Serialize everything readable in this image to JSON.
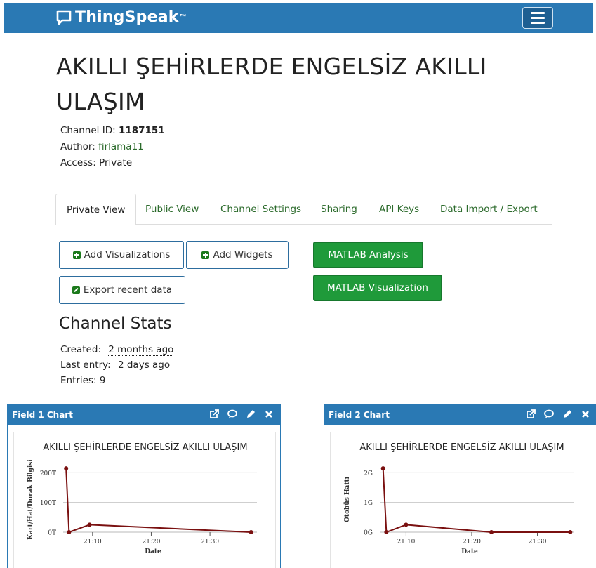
{
  "navbar": {
    "brand": "ThingSpeak",
    "brand_tm": "™",
    "brand_color": "#2a79b4"
  },
  "channel": {
    "title_line1": "AKILLI ŞEHİRLERDE ENGELSİZ AKILLI",
    "title_line2": "ULAŞIM",
    "id_label": "Channel ID:",
    "id_value": "1187151",
    "author_label": "Author:",
    "author_value": "firlama11",
    "access_label": "Access:",
    "access_value": "Private"
  },
  "tabs": [
    {
      "label": "Private View",
      "active": true
    },
    {
      "label": "Public View"
    },
    {
      "label": "Channel Settings"
    },
    {
      "label": "Sharing"
    },
    {
      "label": "API Keys"
    },
    {
      "label": "Data Import / Export"
    }
  ],
  "buttons": {
    "add_visualizations": "Add Visualizations",
    "add_widgets": "Add Widgets",
    "export_recent": "Export recent data",
    "matlab_analysis": "MATLAB Analysis",
    "matlab_visualization": "MATLAB Visualization"
  },
  "stats": {
    "heading": "Channel Stats",
    "created_label": "Created:",
    "created_value": "2 months ago",
    "last_entry_label": "Last entry:",
    "last_entry_value": "2 days ago",
    "entries_label": "Entries:",
    "entries_value": "9"
  },
  "panels": [
    {
      "title": "Field 1 Chart"
    },
    {
      "title": "Field 2 Chart"
    }
  ],
  "chart_data": [
    {
      "type": "line",
      "title": "AKILLI ŞEHİRLERDE ENGELSİZ AKILLI ULAŞIM",
      "xlabel": "Date",
      "ylabel": "Kart/Hat/Durak Bilgisi",
      "x": [
        "21:05",
        "21:06",
        "21:09",
        "21:37"
      ],
      "x_minutes": [
        5.5,
        6.0,
        9.5,
        37.0
      ],
      "y": [
        215000,
        0,
        25000,
        0
      ],
      "ylim": [
        0,
        220000
      ],
      "yticks": [
        {
          "value": 0,
          "label": "0T"
        },
        {
          "value": 100000,
          "label": "100T"
        },
        {
          "value": 200000,
          "label": "200T"
        }
      ],
      "xticks": [
        {
          "value": 10,
          "label": "21:10"
        },
        {
          "value": 20,
          "label": "21:20"
        },
        {
          "value": 30,
          "label": "21:30"
        }
      ],
      "xlim": [
        5,
        38
      ],
      "line_color": "#7a1010",
      "grid": true
    },
    {
      "type": "line",
      "title": "AKILLI ŞEHİRLERDE ENGELSİZ AKILLI ULAŞIM",
      "xlabel": "Date",
      "ylabel": "Otobüs Hattı",
      "x": [
        "21:06",
        "21:07",
        "21:10",
        "21:23",
        "21:35"
      ],
      "x_minutes": [
        6.5,
        7.0,
        10.0,
        23.0,
        35.0
      ],
      "y": [
        2150000000,
        0,
        250000000,
        0,
        0
      ],
      "ylim": [
        0,
        2200000000
      ],
      "yticks": [
        {
          "value": 0,
          "label": "0G"
        },
        {
          "value": 1000000000,
          "label": "1G"
        },
        {
          "value": 2000000000,
          "label": "2G"
        }
      ],
      "xticks": [
        {
          "value": 10,
          "label": "21:10"
        },
        {
          "value": 20,
          "label": "21:20"
        },
        {
          "value": 30,
          "label": "21:30"
        }
      ],
      "xlim": [
        6,
        35.5
      ],
      "line_color": "#7a1010",
      "grid": true
    }
  ]
}
